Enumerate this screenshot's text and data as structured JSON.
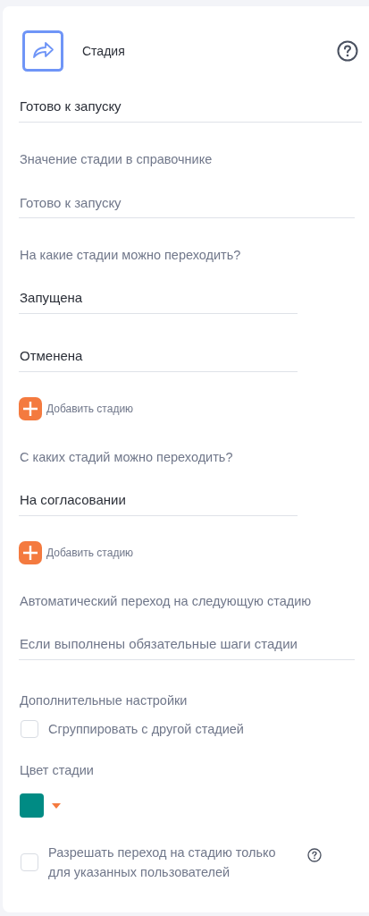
{
  "header": {
    "title": "Стадия"
  },
  "name_field": {
    "value": "Готово к запуску"
  },
  "directory_value": {
    "label": "Значение стадии в справочнике",
    "placeholder": "Готово к запуску"
  },
  "to_stages": {
    "label": "На какие стадии можно переходить?",
    "items": [
      "Запущена",
      "Отменена"
    ],
    "add_label": "Добавить стадию"
  },
  "from_stages": {
    "label": "С каких стадий можно переходить?",
    "items": [
      "На согласовании"
    ],
    "add_label": "Добавить стадию"
  },
  "auto_transition": {
    "label": "Автоматический переход на следующую стадию",
    "value": "Если выполнены обязательные шаги стадии"
  },
  "extra": {
    "label": "Дополнительные настройки",
    "group_option": {
      "label": "Сгруппировать с другой стадией",
      "checked": false
    }
  },
  "stage_color": {
    "label": "Цвет стадии",
    "color": "#008b84"
  },
  "restrict_option": {
    "label": "Разрешать переход на стадию только для указанных пользователей",
    "checked": false
  }
}
